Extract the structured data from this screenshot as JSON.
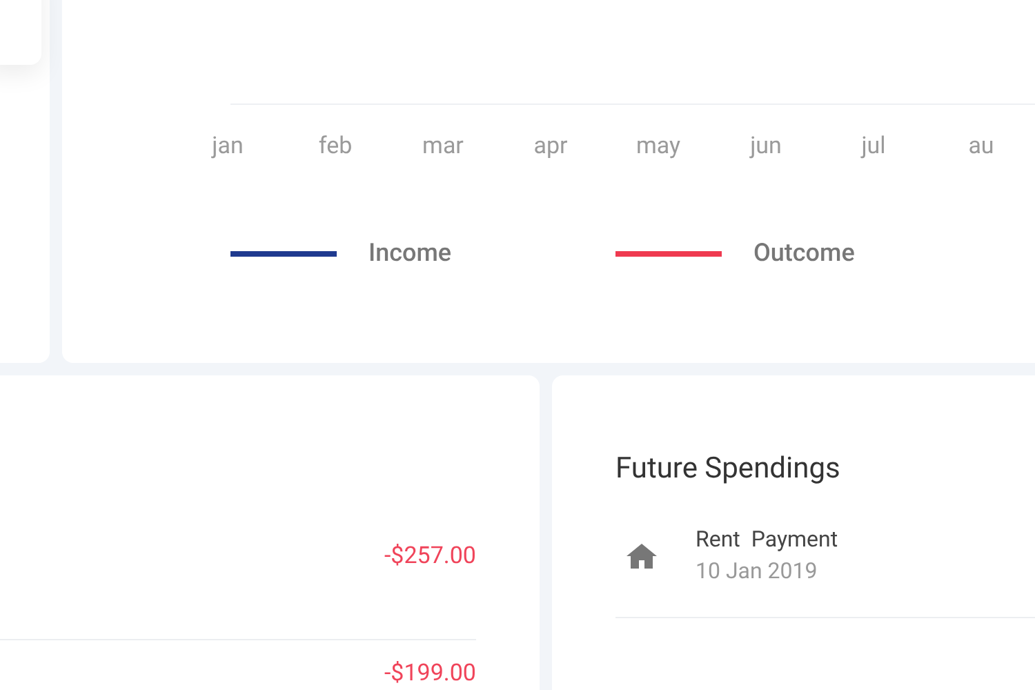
{
  "chart": {
    "x_labels": [
      "jan",
      "feb",
      "mar",
      "apr",
      "may",
      "jun",
      "jul",
      "au"
    ],
    "legend": [
      {
        "label": "Income",
        "color": "#1f3a8f"
      },
      {
        "label": "Outcome",
        "color": "#ef3a50"
      }
    ]
  },
  "transactions": [
    {
      "amount": "-$257.00"
    },
    {
      "amount": "-$199.00"
    }
  ],
  "future_spendings": {
    "title": "Future Spendings",
    "items": [
      {
        "name": "Rent  Payment",
        "date": "10 Jan 2019"
      }
    ]
  }
}
